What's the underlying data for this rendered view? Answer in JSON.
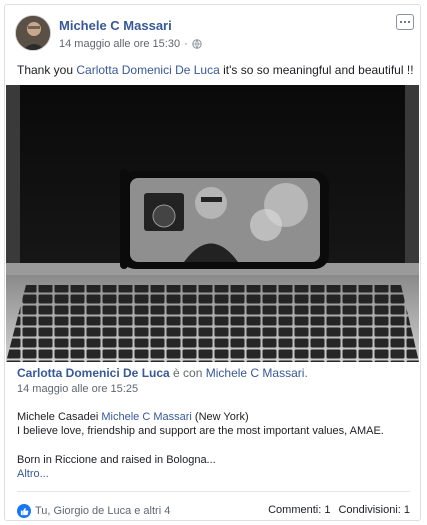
{
  "post": {
    "author": "Michele C Massari",
    "timestamp": "14 maggio alle ore 15:30",
    "privacy_icon": "globe-icon",
    "text_prefix": "Thank you ",
    "text_mention": "Carlotta Domenici De Luca",
    "text_suffix": " it's so so meaningful and beautiful !!"
  },
  "shared": {
    "author": "Carlotta Domenici De Luca",
    "with_text": " è con ",
    "tagged": "Michele C Massari",
    "period": ".",
    "timestamp": "14 maggio alle ore 15:25",
    "line1_prefix": "Michele Casadei ",
    "line1_mention": "Michele C Massari",
    "line1_suffix": " (New York)",
    "line2": "I believe love, friendship and support are the most important values, AMAE.",
    "line3": "Born in Riccione and raised in Bologna...",
    "more": "Altro..."
  },
  "footer": {
    "reactions": "Tu, Giorgio de Luca e altri 4",
    "comments": "Commenti: 1",
    "shares": "Condivisioni: 1"
  },
  "colors": {
    "link": "#385898",
    "like": "#1877f2"
  }
}
